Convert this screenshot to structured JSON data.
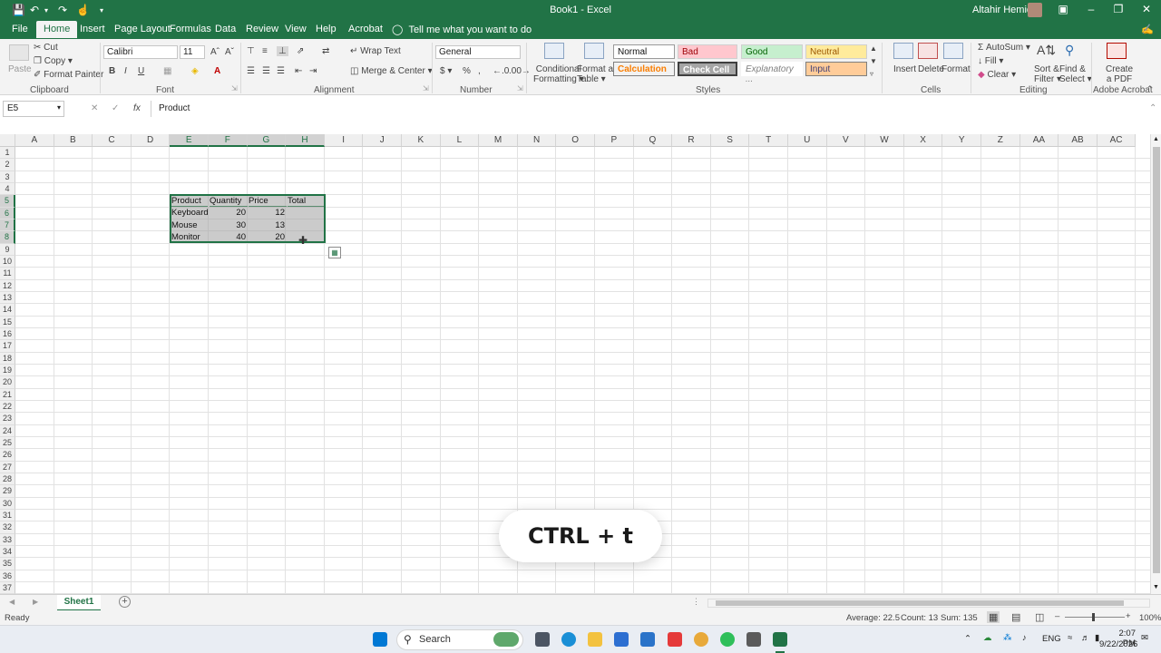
{
  "titlebar": {
    "doc_title": "Book1  -  Excel",
    "user_name": "Altahir Hemida"
  },
  "menu": {
    "tabs": [
      "File",
      "Home",
      "Insert",
      "Page Layout",
      "Formulas",
      "Data",
      "Review",
      "View",
      "Help",
      "Acrobat"
    ],
    "tell_me": "Tell me what you want to do"
  },
  "ribbon": {
    "clipboard": {
      "paste": "Paste",
      "cut": "Cut",
      "copy": "Copy",
      "format_painter": "Format Painter",
      "label": "Clipboard"
    },
    "font": {
      "name": "Calibri",
      "size": "11",
      "label": "Font"
    },
    "alignment": {
      "wrap_text": "Wrap Text",
      "merge_center": "Merge & Center",
      "label": "Alignment"
    },
    "number": {
      "format": "General",
      "label": "Number"
    },
    "styles": {
      "conditional_formatting_1": "Conditional",
      "conditional_formatting_2": "Formatting",
      "format_as_table_1": "Format as",
      "format_as_table_2": "Table",
      "normal": "Normal",
      "bad": "Bad",
      "good": "Good",
      "neutral": "Neutral",
      "calculation": "Calculation",
      "check_cell": "Check Cell",
      "explanatory": "Explanatory ...",
      "input": "Input",
      "label": "Styles"
    },
    "cells": {
      "insert": "Insert",
      "delete": "Delete",
      "format": "Format",
      "label": "Cells"
    },
    "editing": {
      "autosum": "AutoSum",
      "fill": "Fill",
      "clear": "Clear",
      "sort_filter_1": "Sort &",
      "sort_filter_2": "Filter",
      "find_select_1": "Find &",
      "find_select_2": "Select",
      "label": "Editing"
    },
    "acrobat": {
      "create_pdf_1": "Create",
      "create_pdf_2": "a PDF",
      "label": "Adobe Acrobat"
    }
  },
  "formula_bar": {
    "name_box": "E5",
    "fx": "fx",
    "content": "Product"
  },
  "columns": [
    "A",
    "B",
    "C",
    "D",
    "E",
    "F",
    "G",
    "H",
    "I",
    "J",
    "K",
    "L",
    "M",
    "N",
    "O",
    "P",
    "Q",
    "R",
    "S",
    "T",
    "U",
    "V",
    "W",
    "X",
    "Y",
    "Z",
    "AA",
    "AB",
    "AC"
  ],
  "table": {
    "headers": [
      "Product",
      "Quantity",
      "Price",
      "Total"
    ],
    "rows": [
      [
        "Keyboard",
        "20",
        "12",
        ""
      ],
      [
        "Mouse",
        "30",
        "13",
        ""
      ],
      [
        "Monitor",
        "40",
        "20",
        ""
      ]
    ]
  },
  "overlay": {
    "shortcut": "CTRL + t"
  },
  "sheets": {
    "active": "Sheet1"
  },
  "status": {
    "mode": "Ready",
    "average": "Average: 22.5",
    "count": "Count: 13",
    "sum": "Sum: 135",
    "zoom": "100%"
  },
  "taskbar": {
    "search": "Search",
    "lang": "ENG",
    "time": "2:07 PM",
    "date": "9/22/2026"
  },
  "colors": {
    "excel_green": "#217346"
  }
}
